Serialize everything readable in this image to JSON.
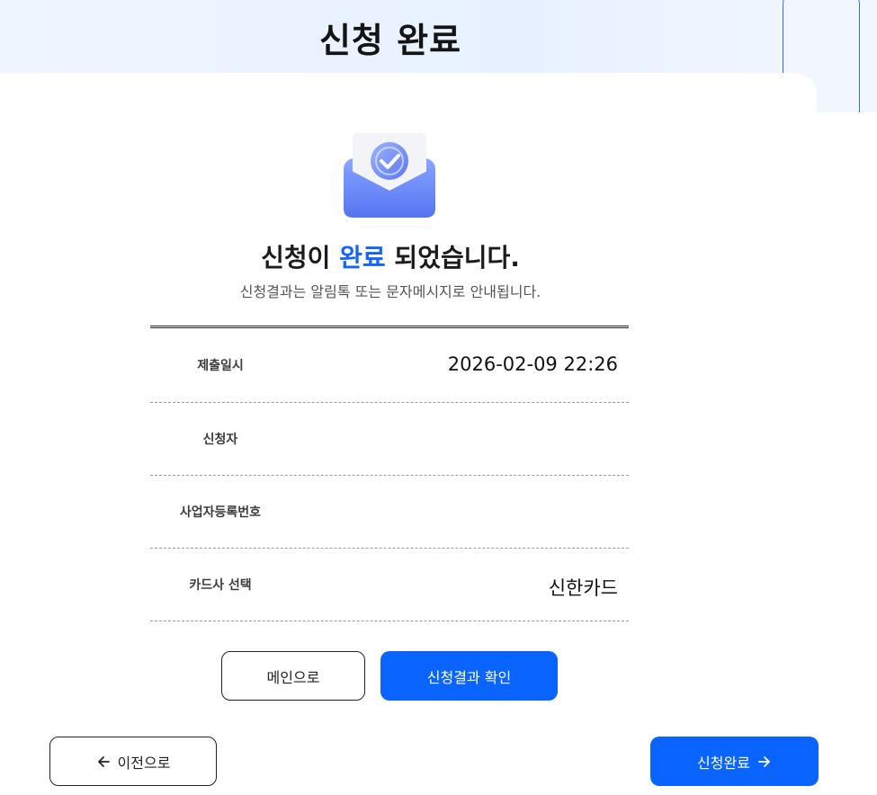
{
  "page": {
    "title": "신청 완료"
  },
  "modal": {
    "headline_prefix": "신청이 ",
    "headline_accent": "완료",
    "headline_suffix": " 되었습니다.",
    "subtitle": "신청결과는 알림톡 또는 문자메시지로 안내됩니다.",
    "rows": [
      {
        "label": "제출일시",
        "value": "2026-02-09 22:26"
      },
      {
        "label": "신청자",
        "value": ""
      },
      {
        "label": "사업자등록번호",
        "value": ""
      },
      {
        "label": "카드사 선택",
        "value": "신한카드"
      }
    ],
    "buttons": {
      "main": "메인으로",
      "result": "신청결과 확인"
    }
  },
  "footer": {
    "prev": "이전으로",
    "done": "신청완료"
  },
  "colors": {
    "accent": "#0a64ff",
    "headline_accent": "#1266f1"
  },
  "icons": {
    "illustration": "envelope-check-icon",
    "prev": "arrow-left-icon",
    "next": "arrow-right-icon"
  }
}
